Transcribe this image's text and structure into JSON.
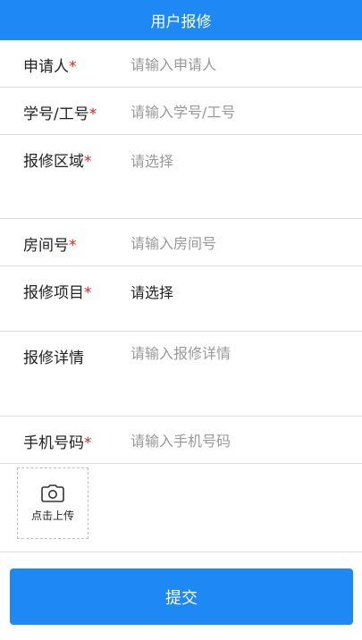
{
  "header": {
    "title": "用户报修"
  },
  "form": {
    "applicant": {
      "label": "申请人",
      "required_mark": "*",
      "placeholder": "请输入申请人"
    },
    "student_id": {
      "label": "学号/工号",
      "required_mark": "*",
      "placeholder": "请输入学号/工号"
    },
    "area": {
      "label": "报修区域",
      "required_mark": "*",
      "value": "请选择"
    },
    "room": {
      "label": "房间号",
      "required_mark": "*",
      "placeholder": "请输入房间号"
    },
    "item": {
      "label": "报修项目",
      "required_mark": "*",
      "value": "请选择"
    },
    "details": {
      "label": "报修详情",
      "placeholder": "请输入报修详情"
    },
    "phone": {
      "label": "手机号码",
      "required_mark": "*",
      "placeholder": "请输入手机号码"
    }
  },
  "upload": {
    "label": "点击上传",
    "icon": "camera-icon"
  },
  "submit": {
    "label": "提交"
  },
  "colors": {
    "primary": "#1e88f5",
    "required": "#e02020",
    "placeholder": "#999999"
  }
}
